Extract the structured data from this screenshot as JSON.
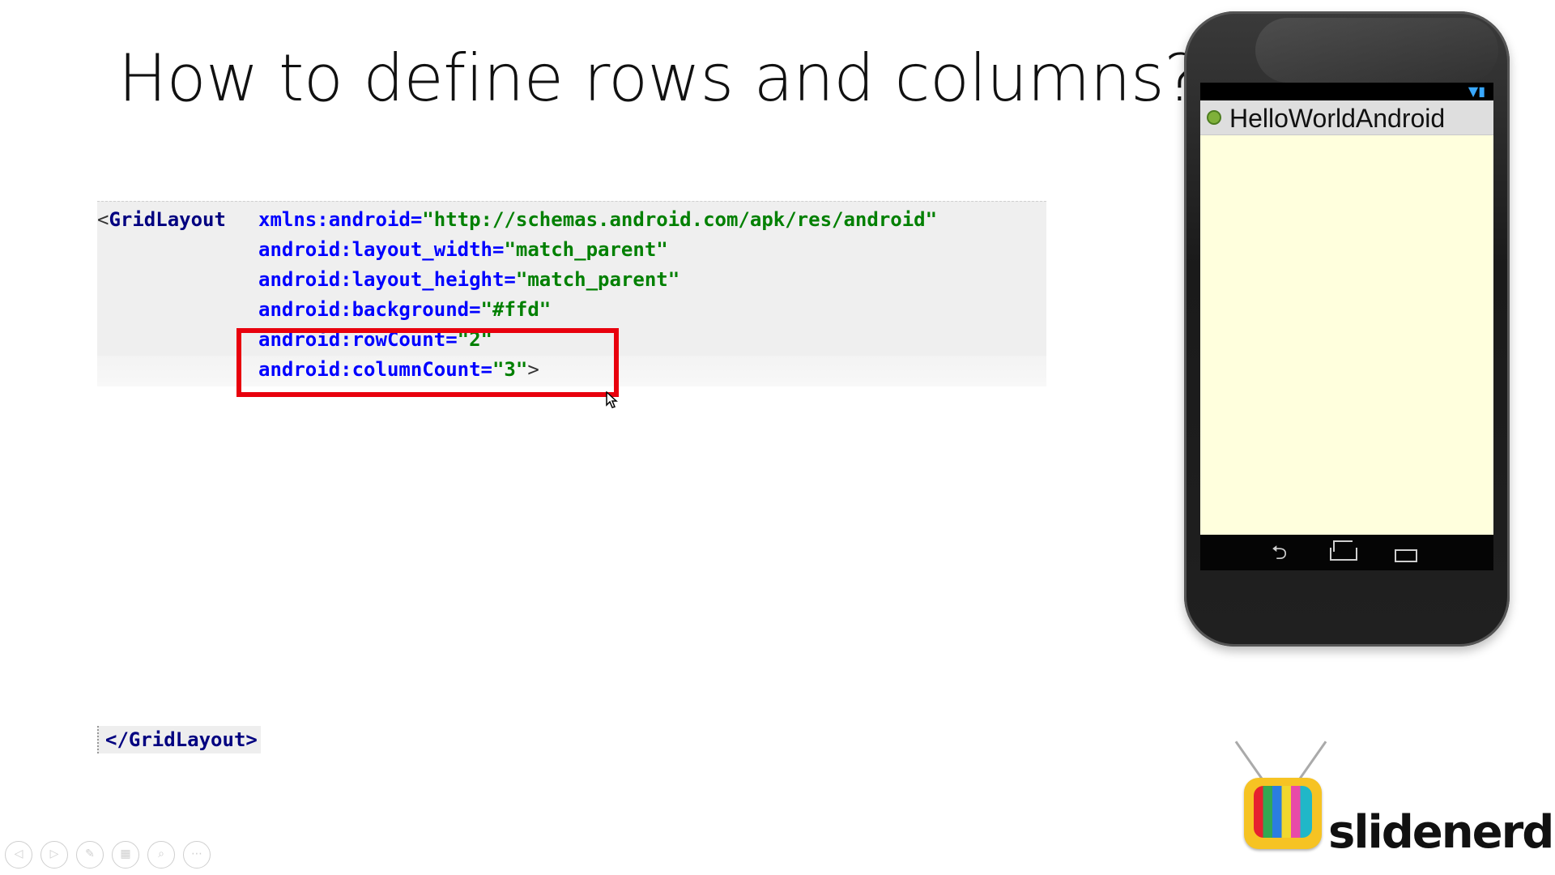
{
  "slide": {
    "title": "How to define rows and columns?"
  },
  "code": {
    "line1_tag": "GridLayout",
    "line1_attr": "xmlns:android=",
    "line1_val": "\"http://schemas.android.com/apk/res/android\"",
    "line2_attr": "android:layout_width=",
    "line2_val": "\"match_parent\"",
    "line3_attr": "android:layout_height=",
    "line3_val": "\"match_parent\"",
    "line4_attr": "android:background=",
    "line4_val": "\"#ffd\"",
    "line5_attr": "android:rowCount=",
    "line5_val": "\"2\"",
    "line6_attr": "android:columnCount=",
    "line6_val": "\"3\"",
    "close_tag": "</GridLayout>"
  },
  "phone": {
    "app_title": "HelloWorldAndroid",
    "screen_background": "#ffffdd"
  },
  "logo": {
    "text": "slidenerd"
  },
  "colors": {
    "highlight": "#e8000d",
    "code_attr": "#0000ff",
    "code_value": "#008000",
    "code_tag": "#000080"
  }
}
